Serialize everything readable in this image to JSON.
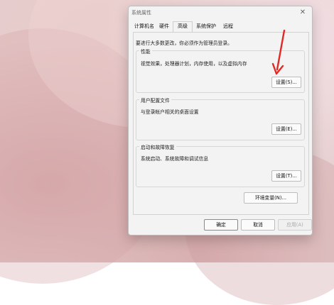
{
  "dialog": {
    "title": "系统属性",
    "close_icon": "close-icon",
    "tabs": [
      {
        "label": "计算机名"
      },
      {
        "label": "硬件"
      },
      {
        "label": "高级"
      },
      {
        "label": "系统保护"
      },
      {
        "label": "远程"
      }
    ],
    "active_tab": "高级",
    "admin_note": "要进行大多数更改，你必须作为管理员登录。",
    "sections": {
      "performance": {
        "title": "性能",
        "description": "视觉效果，处理器计划，内存使用，以及虚拟内存",
        "button": "设置(S)..."
      },
      "user_profiles": {
        "title": "用户配置文件",
        "description": "与登录帐户相关的桌面设置",
        "button": "设置(E)..."
      },
      "startup_recovery": {
        "title": "启动和故障恢复",
        "description": "系统启动、系统故障和调试信息",
        "button": "设置(T)..."
      }
    },
    "env_button": "环境变量(N)...",
    "footer": {
      "ok": "确定",
      "cancel": "取消",
      "apply": "应用(A)"
    }
  },
  "annotation": {
    "arrow_color": "#e02a25"
  }
}
